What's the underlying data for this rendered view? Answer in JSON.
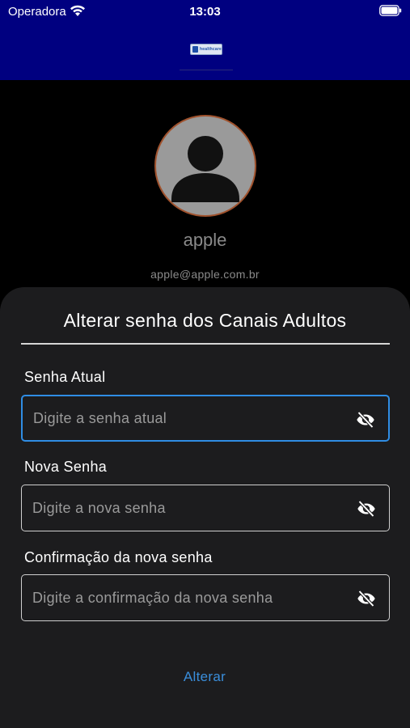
{
  "status_bar": {
    "carrier": "Operadora",
    "time": "13:03"
  },
  "header": {
    "logo_text": "healthcare"
  },
  "profile": {
    "name": "apple",
    "email": "apple@apple.com.br"
  },
  "sheet": {
    "title": "Alterar senha dos Canais Adultos",
    "fields": [
      {
        "label": "Senha Atual",
        "placeholder": "Digite a senha atual",
        "icon": "eye-off-icon"
      },
      {
        "label": "Nova Senha",
        "placeholder": "Digite a nova senha",
        "icon": "eye-off-icon"
      },
      {
        "label": "Confirmação da nova senha",
        "placeholder": "Digite a confirmação da nova senha",
        "icon": "eye-off-icon"
      }
    ],
    "submit_label": "Alterar"
  },
  "colors": {
    "header_bg": "#000080",
    "sheet_bg": "#1c1c1e",
    "accent": "#2f8de4",
    "link": "#3a8edb",
    "avatar_border": "#a0522d"
  }
}
